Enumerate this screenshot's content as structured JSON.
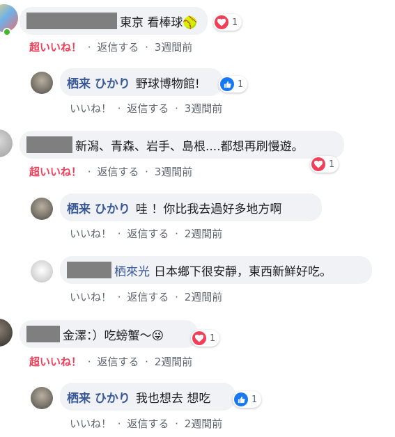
{
  "comments": [
    {
      "text": "東京 看棒球🥎",
      "reaction_count": "1",
      "actions": {
        "like": "超いいね！",
        "reply": "返信する",
        "time": "3週間前"
      },
      "reply": {
        "name": "栖来 ひかり",
        "text": "野球博物館!",
        "reaction_count": "1",
        "actions": {
          "like": "いいね！",
          "reply": "返信する",
          "time": "3週間前"
        }
      }
    },
    {
      "text": "新潟、青森、岩手、島根....都想再刷慢遊。",
      "reaction_count": "1",
      "actions": {
        "like": "超いいね！",
        "reply": "返信する",
        "time": "3週間前"
      },
      "replies": [
        {
          "name": "栖来 ひかり",
          "text": "哇 ！你比我去過好多地方啊",
          "actions": {
            "like": "いいね！",
            "reply": "返信する",
            "time": "2週間前"
          }
        },
        {
          "name": "栖來光",
          "text": "日本鄉下很安靜，東西新鮮好吃。",
          "actions": {
            "like": "いいね！",
            "reply": "返信する",
            "time": "2週間前"
          }
        }
      ]
    },
    {
      "text": "金澤：）吃螃蟹～😜",
      "reaction_count": "1",
      "actions": {
        "like": "超いいね！",
        "reply": "返信する",
        "time": "2週間前"
      },
      "reply": {
        "name": "栖来 ひかり",
        "text": "我也想去 想吃",
        "reaction_count": "1",
        "actions": {
          "like": "いいね！",
          "reply": "返信する",
          "time": "2週間前"
        }
      }
    }
  ],
  "separator": "·",
  "colors": {
    "love": "#f33e58",
    "like": "#1877f2",
    "name": "#385898",
    "bubble": "#f0f2f5"
  },
  "icons": {
    "love": "heart-icon",
    "like": "thumbs-up-icon"
  }
}
